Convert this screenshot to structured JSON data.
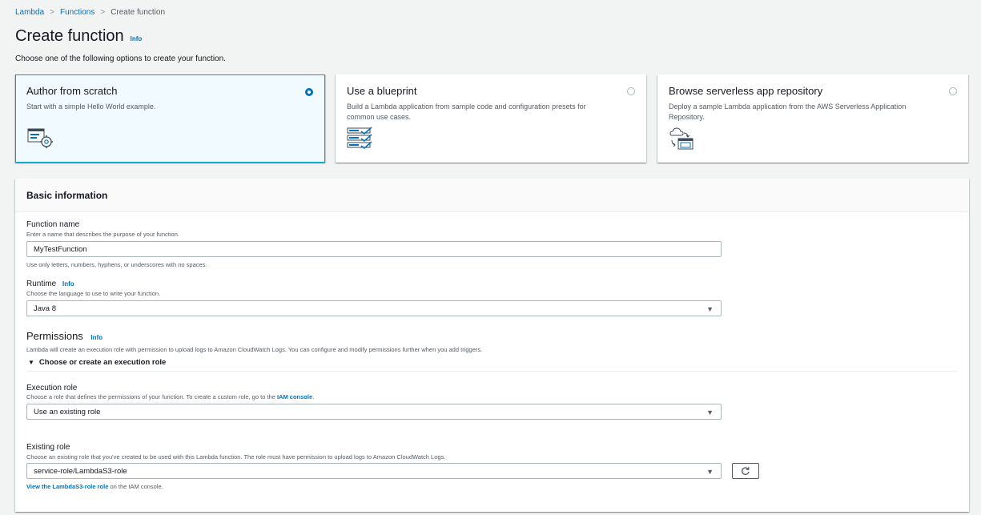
{
  "breadcrumb": {
    "lambda": "Lambda",
    "functions": "Functions",
    "current": "Create function"
  },
  "page": {
    "title": "Create function",
    "info": "Info",
    "description": "Choose one of the following options to create your function."
  },
  "options": [
    {
      "title": "Author from scratch",
      "desc": "Start with a simple Hello World example.",
      "selected": true
    },
    {
      "title": "Use a blueprint",
      "desc": "Build a Lambda application from sample code and configuration presets for common use cases.",
      "selected": false
    },
    {
      "title": "Browse serverless app repository",
      "desc": "Deploy a sample Lambda application from the AWS Serverless Application Repository.",
      "selected": false
    }
  ],
  "basic": {
    "header": "Basic information",
    "function_name": {
      "label": "Function name",
      "hint": "Enter a name that describes the purpose of your function.",
      "value": "MyTestFunction",
      "constraint": "Use only letters, numbers, hyphens, or underscores with no spaces."
    },
    "runtime": {
      "label": "Runtime",
      "info": "Info",
      "hint": "Choose the language to use to write your function.",
      "value": "Java 8"
    },
    "permissions": {
      "title": "Permissions",
      "info": "Info",
      "desc": "Lambda will create an execution role with permission to upload logs to Amazon CloudWatch Logs. You can configure and modify permissions further when you add triggers.",
      "expander": "Choose or create an execution role"
    },
    "execution_role": {
      "label": "Execution role",
      "hint": "Choose a role that defines the permissions of your function. To create a custom role, go to the",
      "hint_link": "IAM console",
      "hint_end": ".",
      "value": "Use an existing role"
    },
    "existing_role": {
      "label": "Existing role",
      "hint": "Choose an existing role that you've created to be used with this Lambda function. The role must have permission to upload logs to Amazon CloudWatch Logs.",
      "value": "service-role/LambdaS3-role",
      "view_link": "View the LambdaS3-role role",
      "view_suffix": " on the IAM console."
    }
  },
  "colors": {
    "link": "#0073bb",
    "selected_bg": "#f1faff",
    "selected_border": "#00a1c9",
    "page_bg": "#f2f3f3"
  },
  "icons": {
    "caret": "▼",
    "breadcrumb_sep": ">",
    "expander": "▼"
  }
}
